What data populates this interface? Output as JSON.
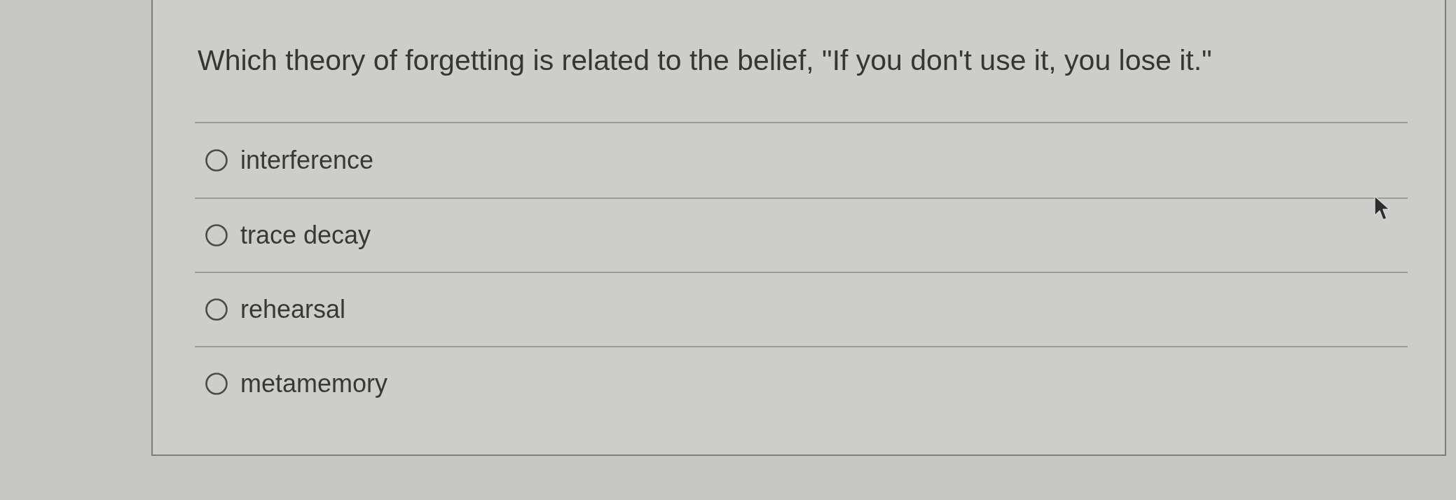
{
  "question": {
    "text": "Which theory of forgetting is related to the belief, \"If you don't use it, you lose it.\""
  },
  "options": [
    {
      "label": "interference",
      "selected": false
    },
    {
      "label": "trace decay",
      "selected": false
    },
    {
      "label": "rehearsal",
      "selected": false
    },
    {
      "label": "metamemory",
      "selected": false
    }
  ]
}
